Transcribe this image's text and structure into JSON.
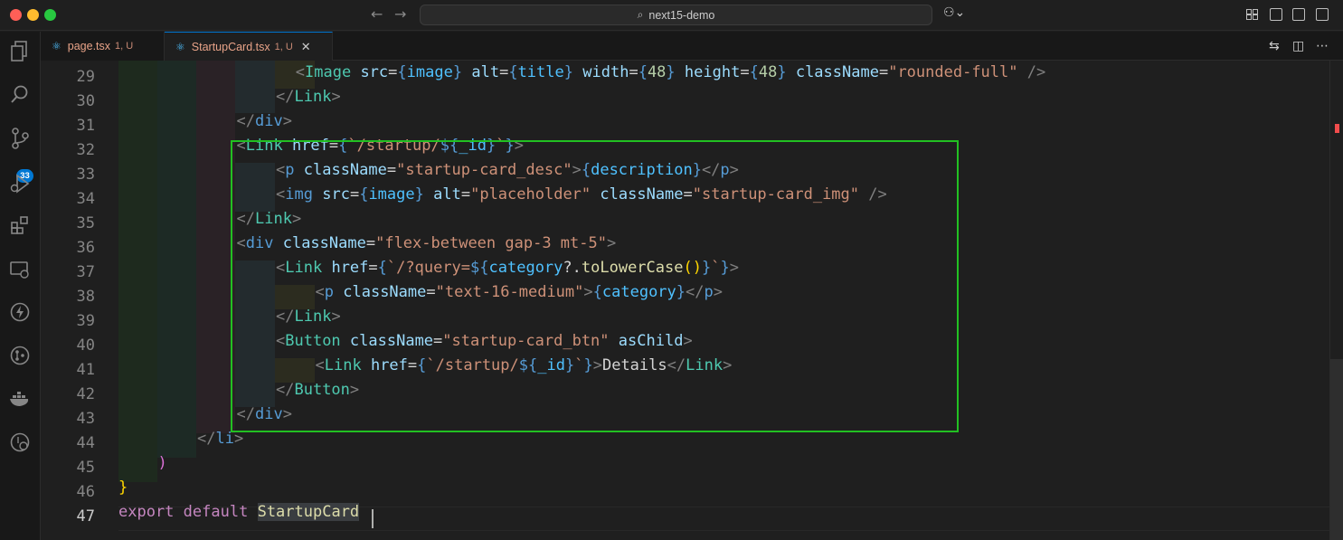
{
  "window": {
    "search_text": "next15-demo"
  },
  "tabs": [
    {
      "label": "page.tsx",
      "status": "1, U"
    },
    {
      "label": "StartupCard.tsx",
      "status": "1, U"
    }
  ],
  "activity": {
    "scm_badge": "33"
  },
  "editor": {
    "line_numbers": [
      "29",
      "30",
      "31",
      "32",
      "33",
      "34",
      "35",
      "36",
      "37",
      "38",
      "39",
      "40",
      "41",
      "42",
      "43",
      "44",
      "45",
      "46",
      "47"
    ]
  }
}
